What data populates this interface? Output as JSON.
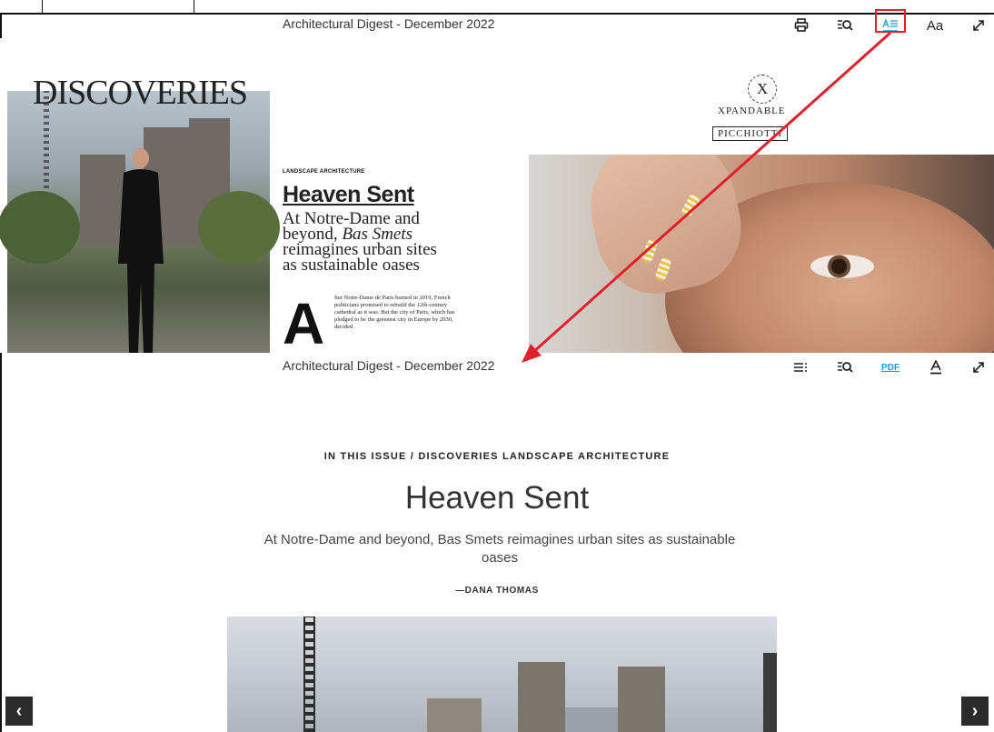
{
  "reader_top": {
    "title": "Architectural Digest - December 2022",
    "buttons": {
      "font_label": "Aa"
    }
  },
  "magazine_page": {
    "section_heading": "DISCOVERIES",
    "kicker": "LANDSCAPE ARCHITECTURE",
    "headline": "Heaven Sent",
    "dek_line1": "At Notre-Dame and",
    "dek_line2": "beyond, ",
    "dek_italic": "Bas Smets",
    "dek_line3": "reimagines urban sites",
    "dek_line4": "as sustainable oases",
    "drop_cap": "A",
    "body": "fter Notre-Dame de Paris burned in 2019, French politicians promised to rebuild the 12th-century cathedral as it was. But the city of Paris, which has pledged to be the greenest city in Europe by 2030, decided",
    "ad_logo_symbol": "X",
    "ad_brand_line1": "XPANDABLE",
    "ad_brand_line2": "PICCHIOTTI"
  },
  "reader_bottom": {
    "title": "Architectural Digest - December 2022",
    "buttons": {
      "pdf_label": "PDF"
    }
  },
  "article": {
    "breadcrumb": "IN THIS ISSUE / DISCOVERIES LANDSCAPE ARCHITECTURE",
    "title": "Heaven Sent",
    "dek": "At Notre-Dame and beyond, Bas Smets reimagines urban sites as sustainable oases",
    "byline": "—DANA THOMAS"
  },
  "nav": {
    "prev": "‹",
    "next": "›"
  },
  "colors": {
    "annotation": "#e0202a",
    "pdf_link": "#1a9ed9",
    "nav_bg": "#2b2b2b"
  }
}
